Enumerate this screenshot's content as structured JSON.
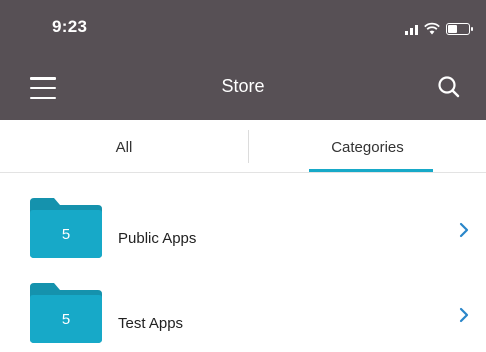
{
  "status_bar": {
    "time": "9:23",
    "icons": [
      "signal-icon",
      "wifi-icon",
      "battery-icon"
    ]
  },
  "nav": {
    "title": "Store",
    "menu_icon": "hamburger-menu-icon",
    "search_icon": "search-icon"
  },
  "tabs": [
    {
      "label": "All",
      "selected": false
    },
    {
      "label": "Categories",
      "selected": true
    }
  ],
  "categories": [
    {
      "count": "5",
      "label": "Public Apps",
      "icon": "folder-icon"
    },
    {
      "count": "5",
      "label": "Test Apps",
      "icon": "folder-icon"
    }
  ],
  "colors": {
    "bar_background": "#575055",
    "accent": "#17a9c8",
    "folder": "#17a9c8",
    "folder_tab": "#1592ad",
    "chevron": "#2a86c9"
  }
}
